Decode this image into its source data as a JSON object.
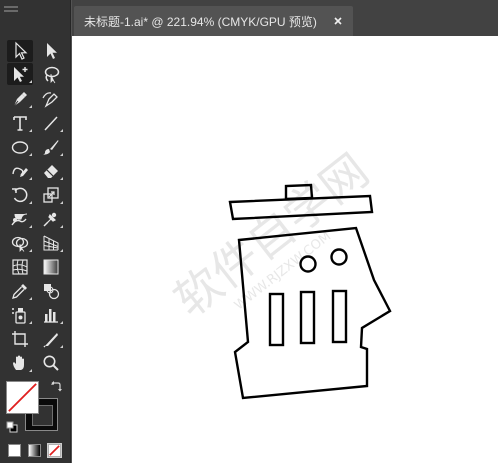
{
  "document_tab": {
    "title": "未标题-1.ai* @ 221.94% (CMYK/GPU 预览)"
  },
  "tools": [
    {
      "name": "selection-tool-icon",
      "active": true
    },
    {
      "name": "direct-selection-tool-icon",
      "active": false
    },
    {
      "name": "magic-wand-tool-icon",
      "active": true
    },
    {
      "name": "lasso-tool-icon",
      "active": false
    },
    {
      "name": "pen-tool-icon",
      "active": false
    },
    {
      "name": "curvature-tool-icon",
      "active": false
    },
    {
      "name": "type-tool-icon",
      "active": false
    },
    {
      "name": "line-segment-tool-icon",
      "active": false
    },
    {
      "name": "ellipse-tool-icon",
      "active": false
    },
    {
      "name": "paintbrush-tool-icon",
      "active": false
    },
    {
      "name": "shaper-tool-icon",
      "active": false
    },
    {
      "name": "eraser-tool-icon",
      "active": false
    },
    {
      "name": "rotate-tool-icon",
      "active": false
    },
    {
      "name": "scale-tool-icon",
      "active": false
    },
    {
      "name": "warp-tool-icon",
      "active": false
    },
    {
      "name": "puppet-warp-tool-icon",
      "active": false
    },
    {
      "name": "shape-builder-tool-icon",
      "active": false
    },
    {
      "name": "perspective-grid-tool-icon",
      "active": false
    },
    {
      "name": "mesh-tool-icon",
      "active": false
    },
    {
      "name": "gradient-tool-icon",
      "active": false
    },
    {
      "name": "eyedropper-tool-icon",
      "active": false
    },
    {
      "name": "blend-tool-icon",
      "active": false
    },
    {
      "name": "symbol-sprayer-tool-icon",
      "active": false
    },
    {
      "name": "column-graph-tool-icon",
      "active": false
    },
    {
      "name": "artboard-tool-icon",
      "active": false
    },
    {
      "name": "slice-tool-icon",
      "active": false
    },
    {
      "name": "hand-tool-icon",
      "active": false
    },
    {
      "name": "zoom-tool-icon",
      "active": false
    }
  ],
  "colors": {
    "fill": "#ffffff",
    "stroke": "#000000",
    "none_slash": "#e02020",
    "panel_bg": "#323232",
    "tabbar_bg": "#424242",
    "canvas_bg": "#ffffff"
  },
  "watermark": {
    "text": "软件自学网",
    "url_text": "WWW.RJZXW.COM"
  }
}
